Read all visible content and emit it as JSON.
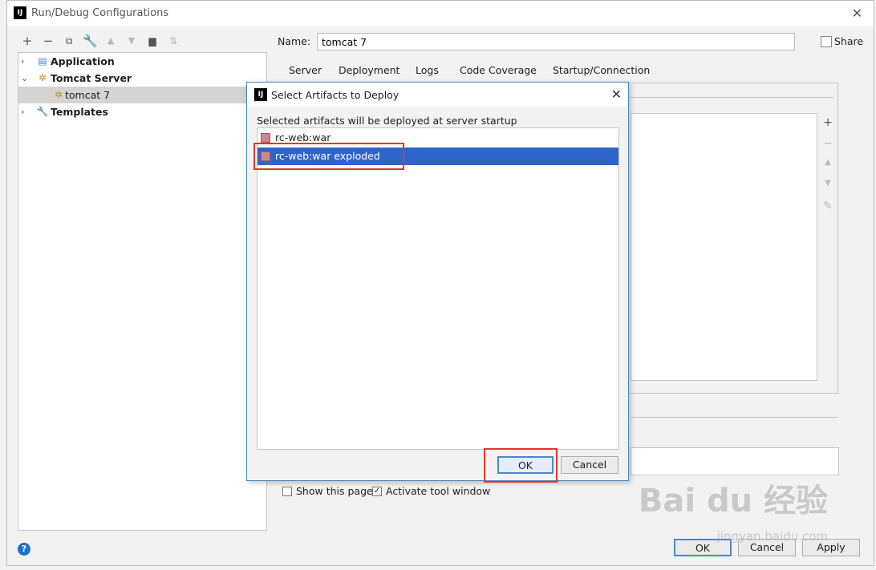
{
  "window": {
    "title": "Run/Debug Configurations",
    "logo": "IJ"
  },
  "toolbar": {
    "icons": [
      "add-icon",
      "remove-icon",
      "copy-icon",
      "wrench-icon",
      "move-up-icon",
      "move-down-icon",
      "folder-icon",
      "sort-icon"
    ]
  },
  "tree": {
    "items": [
      {
        "label": "Application",
        "expanded": false
      },
      {
        "label": "Tomcat Server",
        "expanded": true
      },
      {
        "label": "tomcat 7",
        "selected": true
      },
      {
        "label": "Templates",
        "expanded": false
      }
    ]
  },
  "config": {
    "name_label": "Name:",
    "name_value": "tomcat 7",
    "share_label": "Share",
    "tabs": [
      "Server",
      "Deployment",
      "Logs",
      "Code Coverage",
      "Startup/Connection"
    ],
    "active_tab": "Deployment",
    "show_page_label": "Show this page",
    "activate_tool_label": "Activate tool window"
  },
  "footer": {
    "ok": "OK",
    "cancel": "Cancel",
    "apply": "Apply",
    "help": "?"
  },
  "dialog": {
    "logo": "IJ",
    "title": "Select Artifacts to Deploy",
    "description": "Selected artifacts will be deployed at server startup",
    "artifacts": [
      {
        "label": "rc-web:war",
        "selected": false
      },
      {
        "label": "rc-web:war exploded",
        "selected": true
      }
    ],
    "ok": "OK",
    "cancel": "Cancel"
  },
  "watermark": {
    "brand": "Bai du 经验",
    "url": "jingyan.baidu.com"
  },
  "colors": {
    "selection": "#2f65ca",
    "accent": "#4a88c7",
    "highlight": "#e0362f"
  }
}
